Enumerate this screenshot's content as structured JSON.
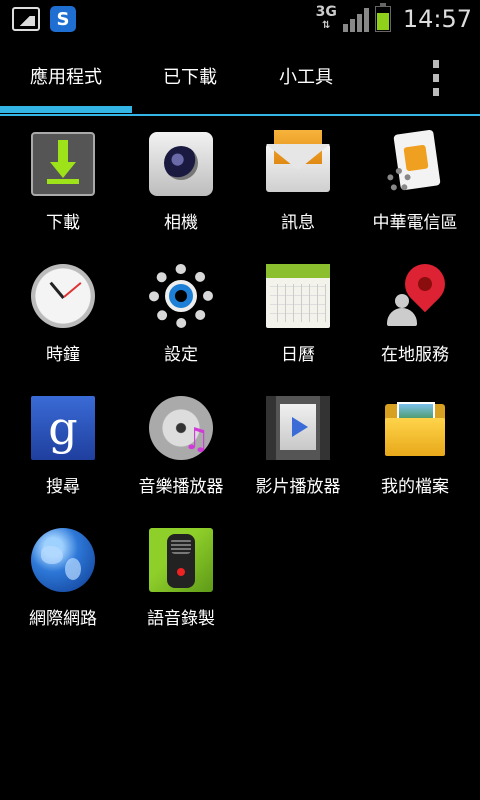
{
  "status_bar": {
    "network": "3G",
    "time": "14:57",
    "battery_level": 0.7,
    "icons": [
      "gallery-notification-icon",
      "skype-notification-icon",
      "signal-icon",
      "battery-icon"
    ]
  },
  "tabs": [
    {
      "label": "應用程式",
      "selected": true
    },
    {
      "label": "已下載",
      "selected": false
    },
    {
      "label": "小工具",
      "selected": false
    }
  ],
  "accent_color": "#33b5e5",
  "apps": [
    {
      "label": "下載",
      "icon": "download-icon"
    },
    {
      "label": "相機",
      "icon": "camera-icon"
    },
    {
      "label": "訊息",
      "icon": "messaging-icon"
    },
    {
      "label": "中華電信區",
      "icon": "sim-toolkit-icon"
    },
    {
      "label": "時鐘",
      "icon": "clock-icon"
    },
    {
      "label": "設定",
      "icon": "settings-gear-icon"
    },
    {
      "label": "日曆",
      "icon": "calendar-icon"
    },
    {
      "label": "在地服務",
      "icon": "local-maps-icon"
    },
    {
      "label": "搜尋",
      "icon": "google-search-icon"
    },
    {
      "label": "音樂播放器",
      "icon": "music-player-icon"
    },
    {
      "label": "影片播放器",
      "icon": "video-player-icon"
    },
    {
      "label": "我的檔案",
      "icon": "folder-icon"
    },
    {
      "label": "網際網路",
      "icon": "globe-icon"
    },
    {
      "label": "語音錄製",
      "icon": "voice-recorder-icon"
    }
  ]
}
